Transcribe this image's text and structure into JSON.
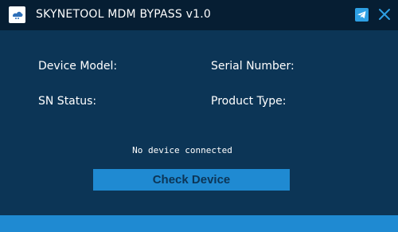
{
  "window": {
    "title": "SKYNETOOL MDM BYPASS v1.0",
    "logo_icon": "app-logo-icon",
    "telegram_icon": "telegram-icon",
    "close_icon": "close-icon"
  },
  "fields": {
    "device_model_label": "Device Model:",
    "device_model_value": "",
    "serial_number_label": "Serial Number:",
    "serial_number_value": "",
    "sn_status_label": "SN Status:",
    "sn_status_value": "",
    "product_type_label": "Product Type:",
    "product_type_value": ""
  },
  "status": {
    "text": "No device connected"
  },
  "actions": {
    "check_device_label": "Check Device"
  },
  "colors": {
    "background": "#0c3556",
    "titlebar": "#061e33",
    "accent": "#1f8ad2",
    "telegram": "#2ea0e4"
  }
}
